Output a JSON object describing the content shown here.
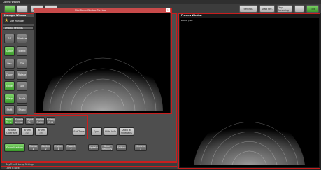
{
  "window": {
    "title": "Control Window"
  },
  "top_tabs": [
    "",
    "",
    "D Mode",
    "Mosaic"
  ],
  "top_right_buttons": [
    "Settings",
    "Start Rec.",
    "Stop Recording",
    "",
    "Exit"
  ],
  "manager": {
    "title": "Manager Window",
    "sub_title": "Site Manager"
  },
  "display_settings": {
    "label": "Display Settings"
  },
  "left_rows": [
    [
      "Off",
      "Shadow",
      "Color",
      "Blend"
    ],
    [
      "Pan",
      "Tilt",
      "Zoom",
      "Rotate"
    ],
    [
      "Edge",
      "Grid",
      "Stereo",
      "Mask"
    ],
    [
      "Warp",
      "Scale",
      "Bright",
      "Contrast"
    ],
    [
      "Shift",
      "Sharp",
      "Gamma",
      "Hue"
    ]
  ],
  "bottom_left": {
    "row1": [
      "Reload Overlays",
      "Brush (1)",
      "Brush (2)"
    ],
    "row2": [
      "Now Time",
      "Enable Observatory",
      "Night Sky",
      "Horizon Guide",
      "Fullsky Grid"
    ]
  },
  "center_buttons": {
    "top": [
      "Set Time"
    ],
    "right": [
      "Sync",
      "Hide Info",
      "Draw all Overlays"
    ]
  },
  "bottom_bar": {
    "green_label": "Show Markers",
    "items": [
      "Marker 1",
      "Marker 2",
      "Project 1",
      "Project 2",
      "Update",
      "Sync Vehicles",
      "Edition",
      "Mirrored 1"
    ]
  },
  "collapsed": [
    "Day/Eve & Lamp Settings",
    "Light & Lock"
  ],
  "floating_window": {
    "title": "Mini Dome Window Preview"
  },
  "preview": {
    "title": "Preview Window",
    "small_text": "Dome (3D)"
  },
  "colors": {
    "red_frame": "#c81e1e",
    "accent_green": "#4caf3a",
    "panel_gray": "#565656"
  }
}
